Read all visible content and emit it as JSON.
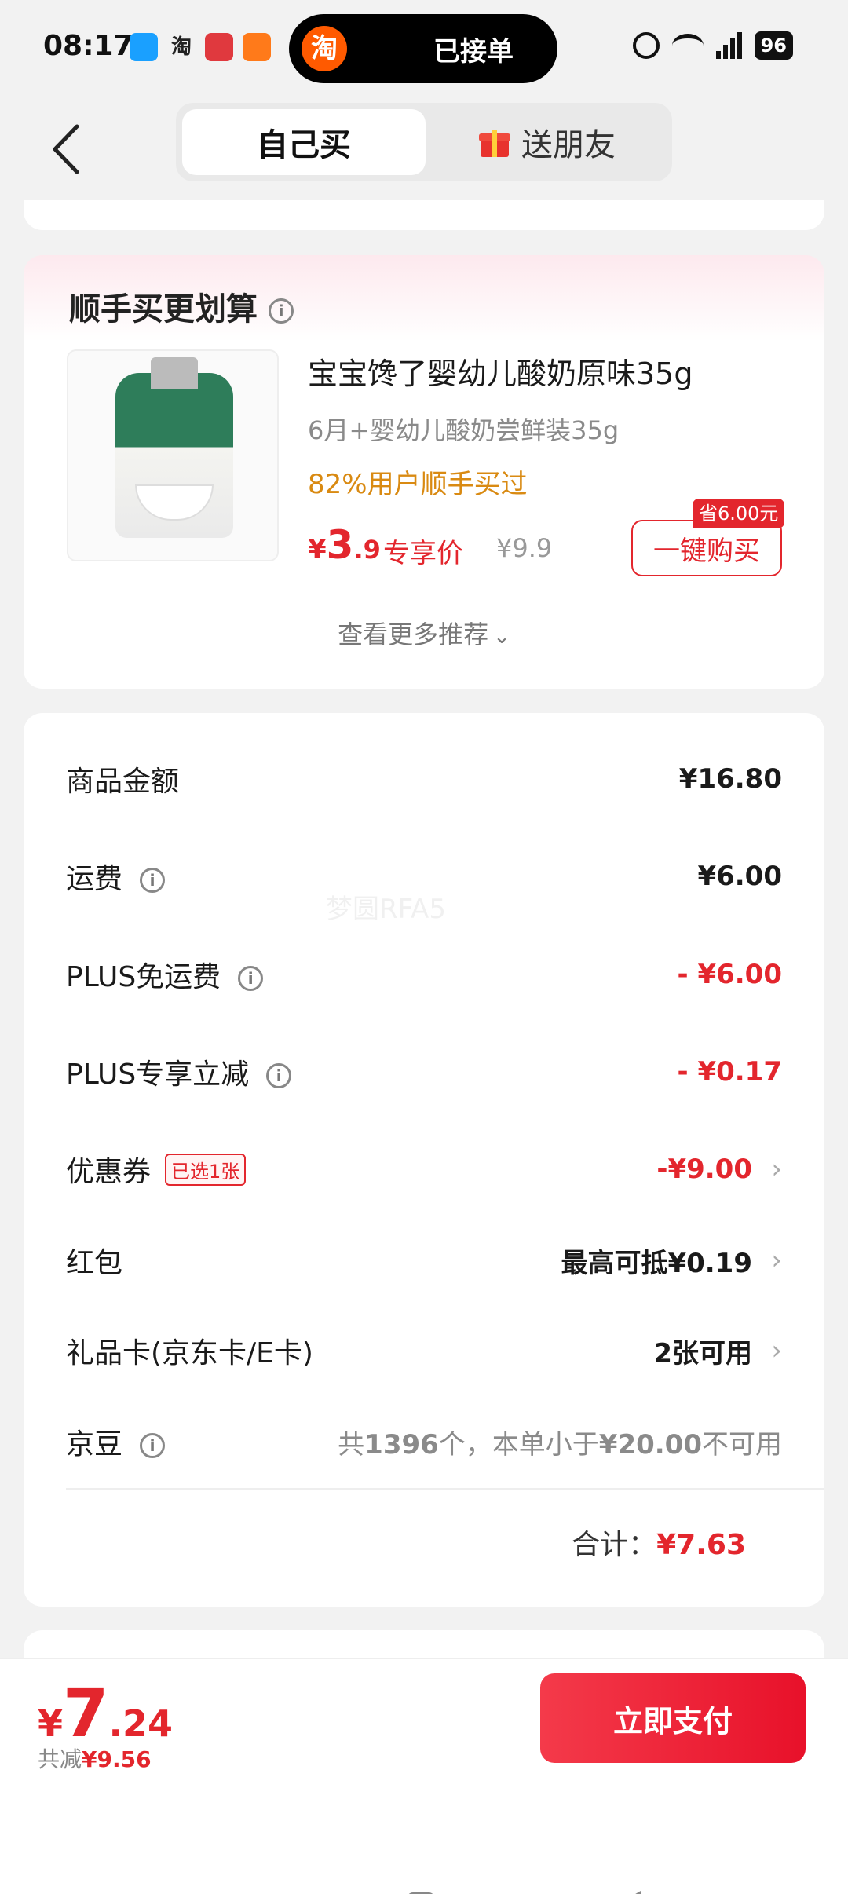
{
  "status_bar": {
    "time": "08:17",
    "island_logo": "淘",
    "island_text": "已接单",
    "battery": "96",
    "notif_glyph": "淘"
  },
  "header": {
    "tabs": [
      {
        "label": "自己买",
        "active": true
      },
      {
        "label": "送朋友",
        "active": false,
        "icon": "gift-icon"
      }
    ]
  },
  "recommend": {
    "title": "顺手买更划算",
    "product": {
      "name": "宝宝馋了婴幼儿酸奶原味35g",
      "subtitle": "6月+婴幼儿酸奶尝鲜装35g",
      "hint": "82%用户顺手买过",
      "price_currency": "¥",
      "price_int": "3",
      "price_dec": ".9",
      "price_tag": "专享价",
      "original_price": "¥9.9",
      "save_badge": "省6.00元",
      "buy_label": "一键购买"
    },
    "more_label": "查看更多推荐"
  },
  "details": {
    "rows": [
      {
        "label": "商品金额",
        "value": "¥16.80"
      },
      {
        "label": "运费",
        "value": "¥6.00"
      },
      {
        "label": "PLUS免运费",
        "value": "- ¥6.00"
      },
      {
        "label": "PLUS专享立减",
        "value": "- ¥0.17"
      },
      {
        "label": "优惠券",
        "badge": "已选1张",
        "value": "-¥9.00"
      },
      {
        "label": "红包",
        "value": "最高可抵¥0.19"
      },
      {
        "label": "礼品卡(京东卡/E卡)",
        "value": "2张可用"
      },
      {
        "label": "京豆",
        "value_prefix": "共",
        "value_count": "1396",
        "value_mid": "个，本单小于",
        "value_amount": "¥20.00",
        "value_suffix": "不可用"
      }
    ],
    "total_label": "合计：",
    "total_value": "¥7.63",
    "watermark": "梦圆RFA5"
  },
  "pay": {
    "currency": "¥",
    "int": "7",
    "dec": ".24",
    "saved_label": "共减",
    "saved_value": "¥9.56",
    "button": "立即支付"
  },
  "colors": {
    "accent_red": "#e3262d",
    "hint_orange": "#d98a12",
    "background": "#f2f2f2"
  }
}
